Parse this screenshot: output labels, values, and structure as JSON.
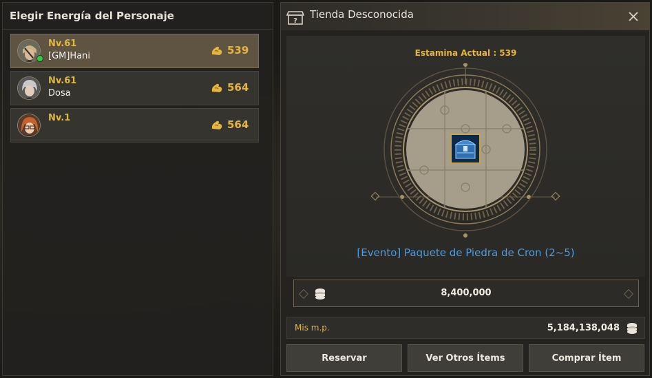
{
  "left_panel": {
    "title": "Elegir Energía del Personaje",
    "characters": [
      {
        "level": "Nv.61",
        "name": "[GM]Hani",
        "stamina": "539",
        "selected": true,
        "online": true,
        "avatar_icon": "male-warrior-portrait"
      },
      {
        "level": "Nv.61",
        "name": "Dosa",
        "stamina": "564",
        "selected": false,
        "online": false,
        "avatar_icon": "silver-hair-portrait"
      },
      {
        "level": "Nv.1",
        "name": "",
        "stamina": "564",
        "selected": false,
        "online": false,
        "avatar_icon": "red-hair-portrait"
      }
    ]
  },
  "shop": {
    "title": "Tienda Desconocida",
    "stamina_label": "Estamina Actual : 539",
    "item_name": "[Evento] Paquete de Piedra de Cron (2~5)",
    "price": "8,400,000",
    "mp_label": "Mis m.p.",
    "mp_value": "5,184,138,048",
    "buttons": {
      "reserve": "Reservar",
      "view_others": "Ver Otros Ítems",
      "buy": "Comprar Ítem"
    }
  },
  "colors": {
    "gold_text": "#e6b540",
    "item_blue": "#4f9be0",
    "selected_row": "#5e5441"
  }
}
